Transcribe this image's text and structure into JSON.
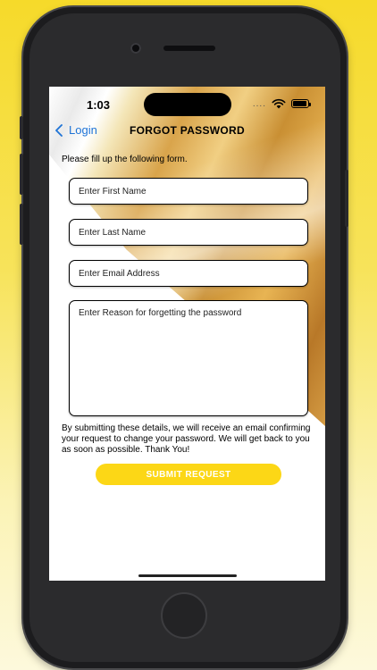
{
  "status_bar": {
    "time": "1:03",
    "dots": "...."
  },
  "nav": {
    "back_label": "Login",
    "title": "FORGOT PASSWORD"
  },
  "form": {
    "instructions": "Please fill up the following form.",
    "first_name_placeholder": "Enter First Name",
    "last_name_placeholder": "Enter Last Name",
    "email_placeholder": "Enter Email Address",
    "reason_placeholder": "Enter Reason for forgetting the password",
    "note": "By submitting these details, we will receive an email confirming your request to change your password. We will get back to you as soon as possible. Thank You!",
    "submit_label": "SUBMIT REQUEST"
  },
  "icons": {
    "back": "chevron-left-icon",
    "wifi": "wifi-icon",
    "battery": "battery-icon"
  },
  "colors": {
    "accent": "#1e73d6",
    "button": "#fcd716",
    "background": "#f6da2a"
  }
}
